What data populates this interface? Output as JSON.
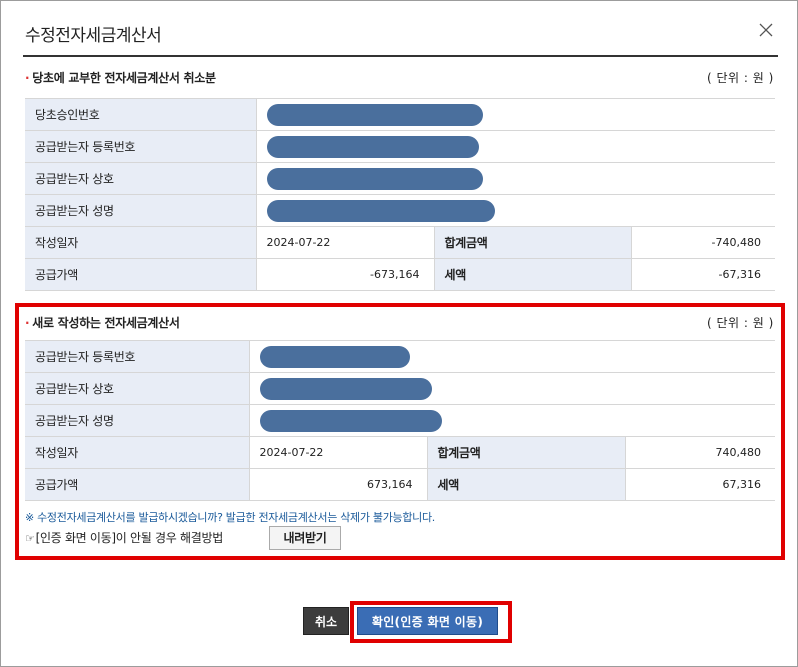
{
  "dialog": {
    "title": "수정전자세금계산서"
  },
  "original": {
    "heading": "당초에 교부한 전자세금계산서 취소분",
    "unit": "( 단위 : 원 )",
    "labels": {
      "approval_no": "당초승인번호",
      "recipient_reg_no": "공급받는자 등록번호",
      "recipient_company": "공급받는자 상호",
      "recipient_name": "공급받는자 성명",
      "issue_date": "작성일자",
      "total_amount": "합계금액",
      "supply_amount": "공급가액",
      "tax_amount": "세액"
    },
    "values": {
      "issue_date": "2024-07-22",
      "total_amount": "-740,480",
      "supply_amount": "-673,164",
      "tax_amount": "-67,316"
    }
  },
  "new_invoice": {
    "heading": "새로 작성하는 전자세금계산서",
    "unit": "( 단위 : 원 )",
    "labels": {
      "recipient_reg_no": "공급받는자 등록번호",
      "recipient_company": "공급받는자 상호",
      "recipient_name": "공급받는자 성명",
      "issue_date": "작성일자",
      "total_amount": "합계금액",
      "supply_amount": "공급가액",
      "tax_amount": "세액"
    },
    "values": {
      "issue_date": "2024-07-22",
      "total_amount": "740,480",
      "supply_amount": "673,164",
      "tax_amount": "67,316"
    },
    "notice": "※ 수정전자세금계산서를 발급하시겠습니까? 발급한 전자세금계산서는 삭제가 불가능합니다.",
    "help_text": "[인증 화면 이동]이 안될 경우 해결방법",
    "download_button": "내려받기"
  },
  "footer": {
    "cancel_button": "취소",
    "confirm_button": "확인(인증 화면 이동)"
  },
  "colors": {
    "highlight": "#e00000",
    "confirm": "#3a6db5",
    "cancel": "#3d3d3d",
    "label_bg": "#e8edf6",
    "redaction": "#4a6f9d"
  }
}
